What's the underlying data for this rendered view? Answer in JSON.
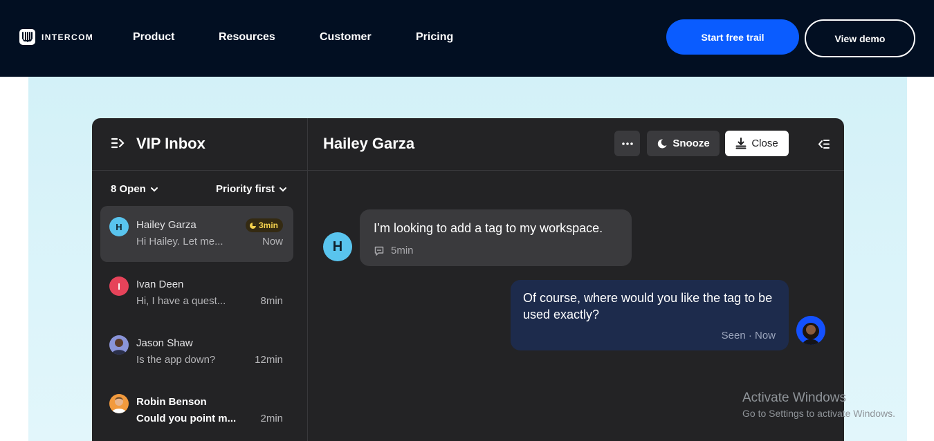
{
  "nav": {
    "brand": "INTERCOM",
    "links": [
      "Product",
      "Resources",
      "Customer",
      "Pricing"
    ],
    "cta_primary": "Start free trail",
    "cta_secondary": "View demo"
  },
  "inbox": {
    "title": "VIP Inbox",
    "status_filter": "8 Open",
    "sort_filter": "Priority first",
    "conversations": [
      {
        "initial": "H",
        "name": "Hailey Garza",
        "preview": "Hi Hailey. Let me...",
        "time": "Now",
        "badge": "3min",
        "avatar_color": "#59c4ee",
        "active": true
      },
      {
        "initial": "I",
        "name": "Ivan Deen",
        "preview": "Hi, I have a quest...",
        "time": "8min",
        "avatar_color": "#e6435a"
      },
      {
        "initial": "",
        "name": "Jason Shaw",
        "preview": "Is the app down?",
        "time": "12min",
        "avatar_color": "#8a94d8"
      },
      {
        "initial": "",
        "name": "Robin Benson",
        "preview": "Could you point m...",
        "time": "2min",
        "avatar_color": "#f29a3d",
        "unread": true
      }
    ]
  },
  "conversation": {
    "title": "Hailey Garza",
    "more_icon": "more-dots-icon",
    "snooze_label": "Snooze",
    "close_label": "Close",
    "messages": [
      {
        "from": "customer",
        "avatar_initial": "H",
        "text": "I’m looking to add a tag to my workspace.",
        "meta": "5min"
      },
      {
        "from": "agent",
        "text": "Of course, where would you like the tag to be used exactly?",
        "meta": "Seen · Now"
      }
    ]
  },
  "watermark": {
    "title": "Activate Windows",
    "subtitle": "Go to Settings to activate Windows."
  },
  "colors": {
    "nav_bg": "#020f22",
    "primary_button": "#0a5cff",
    "hero_bg": "#d3f1f8",
    "app_bg": "#232325",
    "agent_bubble": "#1d2b4c",
    "badge_text": "#f4d14d"
  }
}
